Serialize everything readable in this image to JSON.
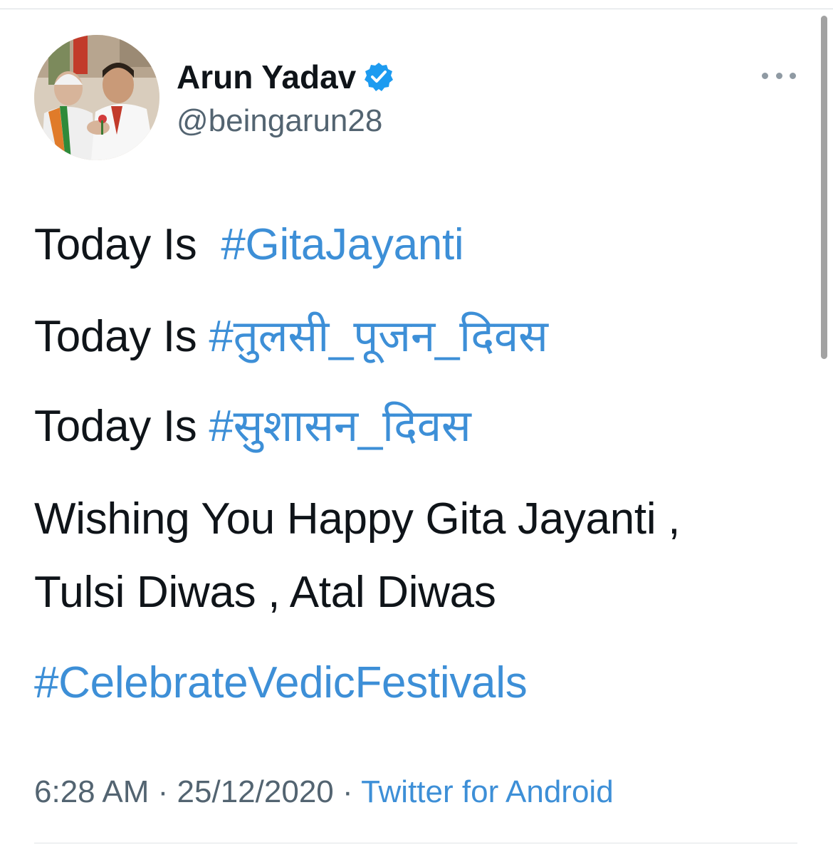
{
  "tweet": {
    "author": {
      "display_name": "Arun Yadav",
      "handle": "@beingarun28",
      "verified": true
    },
    "lines": [
      {
        "prefix": "Today Is  ",
        "hashtag": "#GitaJayanti"
      },
      {
        "prefix": "Today Is ",
        "hashtag": "#तुलसी_पूजन_दिवस"
      },
      {
        "prefix": "Today Is ",
        "hashtag": "#सुशासन_दिवस"
      }
    ],
    "message_line_1": "Wishing You Happy Gita Jayanti ,",
    "message_line_2": "Tulsi Diwas , Atal Diwas",
    "closing_hashtag": "#CelebrateVedicFestivals",
    "meta": {
      "time": "6:28 AM",
      "separator": " · ",
      "date": "25/12/2020",
      "source": "Twitter for Android"
    }
  },
  "icons": {
    "verified": "verified-badge-icon",
    "more": "more-options-icon"
  },
  "colors": {
    "link": "#3d8fd7",
    "text": "#0f1419",
    "secondary": "#536471",
    "verified": "#1d9bf0"
  }
}
